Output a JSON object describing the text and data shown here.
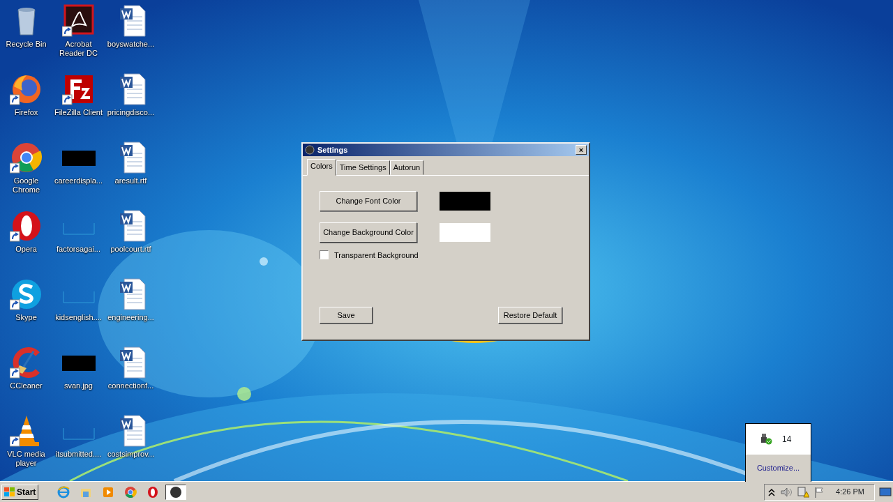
{
  "desktop_icons": [
    {
      "label": "Recycle Bin",
      "kind": "recycle-bin",
      "shortcut": false
    },
    {
      "label": "Acrobat Reader DC",
      "kind": "acrobat",
      "shortcut": true
    },
    {
      "label": "boyswatche...",
      "kind": "word",
      "shortcut": false
    },
    {
      "label": "Firefox",
      "kind": "firefox",
      "shortcut": true
    },
    {
      "label": "FileZilla Client",
      "kind": "filezilla",
      "shortcut": true
    },
    {
      "label": "pricingdisco...",
      "kind": "word",
      "shortcut": false
    },
    {
      "label": "Google Chrome",
      "kind": "chrome",
      "shortcut": true
    },
    {
      "label": "careerdispla...",
      "kind": "dark-thumb",
      "shortcut": false
    },
    {
      "label": "aresult.rtf",
      "kind": "word",
      "shortcut": false
    },
    {
      "label": "Opera",
      "kind": "opera",
      "shortcut": true
    },
    {
      "label": "factorsagai...",
      "kind": "faint-thumb",
      "shortcut": false
    },
    {
      "label": "poolcourt.rtf",
      "kind": "word",
      "shortcut": false
    },
    {
      "label": "Skype",
      "kind": "skype",
      "shortcut": true
    },
    {
      "label": "kidsenglish....",
      "kind": "faint-thumb",
      "shortcut": false
    },
    {
      "label": "engineering...",
      "kind": "word",
      "shortcut": false
    },
    {
      "label": "CCleaner",
      "kind": "ccleaner",
      "shortcut": true
    },
    {
      "label": "svan.jpg",
      "kind": "dark-thumb",
      "shortcut": false
    },
    {
      "label": "connectionf...",
      "kind": "word",
      "shortcut": false
    },
    {
      "label": "VLC media player",
      "kind": "vlc",
      "shortcut": true
    },
    {
      "label": "itsubmitted....",
      "kind": "faint-thumb",
      "shortcut": false
    },
    {
      "label": "costsimprov...",
      "kind": "word",
      "shortcut": false
    }
  ],
  "dialog": {
    "title": "Settings",
    "close": "×",
    "tabs": [
      {
        "label": "Colors",
        "selected": true
      },
      {
        "label": "Time Settings",
        "selected": false
      },
      {
        "label": "Autorun",
        "selected": false
      }
    ],
    "color_rows": [
      {
        "button": "Change Font Color",
        "color": "#000000"
      },
      {
        "button": "Change Background Color",
        "color": "#ffffff"
      }
    ],
    "transparent_background": {
      "label": "Transparent Background",
      "checked": false
    },
    "save_button": "Save",
    "restore_button": "Restore Default"
  },
  "tray_popup": {
    "count": "14",
    "link": "Customize..."
  },
  "taskbar": {
    "start": "Start",
    "items": [
      {
        "kind": "ie",
        "selected": false
      },
      {
        "kind": "explorer",
        "selected": false
      },
      {
        "kind": "media",
        "selected": false
      },
      {
        "kind": "chrome",
        "selected": false
      },
      {
        "kind": "opera",
        "selected": false
      },
      {
        "kind": "settings-app",
        "selected": true
      }
    ],
    "clock": "4:26 PM"
  }
}
